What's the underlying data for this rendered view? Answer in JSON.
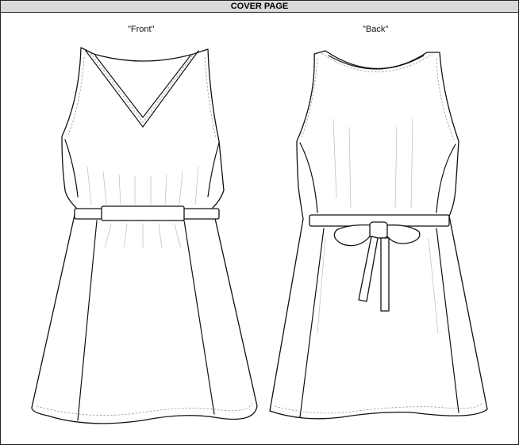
{
  "header": {
    "title": "COVER PAGE"
  },
  "views": {
    "front": {
      "label": "\"Front\""
    },
    "back": {
      "label": "\"Back\""
    }
  }
}
